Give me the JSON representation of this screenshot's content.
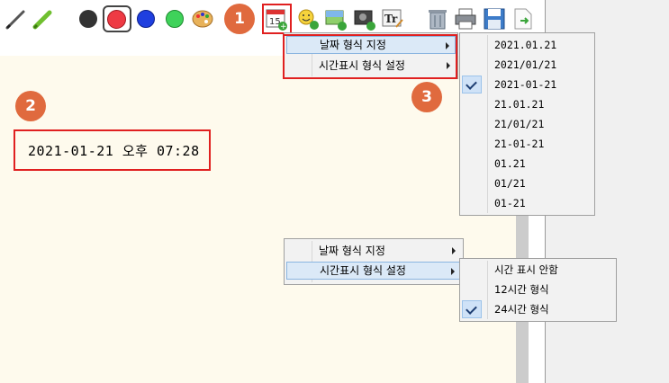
{
  "colors": {
    "badge": "#e06a3e",
    "highlight_box": "#e02020",
    "canvas": "#fefaed",
    "selected_color": "#e8303a"
  },
  "toolbar": {
    "tools": [
      {
        "name": "pencil-icon"
      },
      {
        "name": "marker-icon"
      },
      {
        "name": "color-black"
      },
      {
        "name": "color-red"
      },
      {
        "name": "color-blue"
      },
      {
        "name": "color-green"
      },
      {
        "name": "palette-icon"
      },
      {
        "name": "calendar-icon",
        "text": "15"
      },
      {
        "name": "emoji-icon"
      },
      {
        "name": "image-icon"
      },
      {
        "name": "photo-icon"
      },
      {
        "name": "text-tool-icon",
        "text": "Tr"
      },
      {
        "name": "trash-icon"
      },
      {
        "name": "print-icon"
      },
      {
        "name": "save-icon"
      },
      {
        "name": "export-icon"
      }
    ]
  },
  "badges": [
    "1",
    "2",
    "3"
  ],
  "canvas_text": "2021-01-21 오후 07:28",
  "menu_top": {
    "items": [
      "날짜 형식 지정",
      "시간표시 형식 설정"
    ]
  },
  "date_submenu": {
    "items": [
      "2021.01.21",
      "2021/01/21",
      "2021-01-21",
      "21.01.21",
      "21/01/21",
      "21-01-21",
      "01.21",
      "01/21",
      "01-21"
    ],
    "checked_index": 2
  },
  "menu_bottom": {
    "items": [
      "날짜 형식 지정",
      "시간표시 형식 설정"
    ]
  },
  "time_submenu": {
    "items": [
      "시간 표시 안함",
      "12시간 형식",
      "24시간 형식"
    ],
    "checked_index": 2
  }
}
